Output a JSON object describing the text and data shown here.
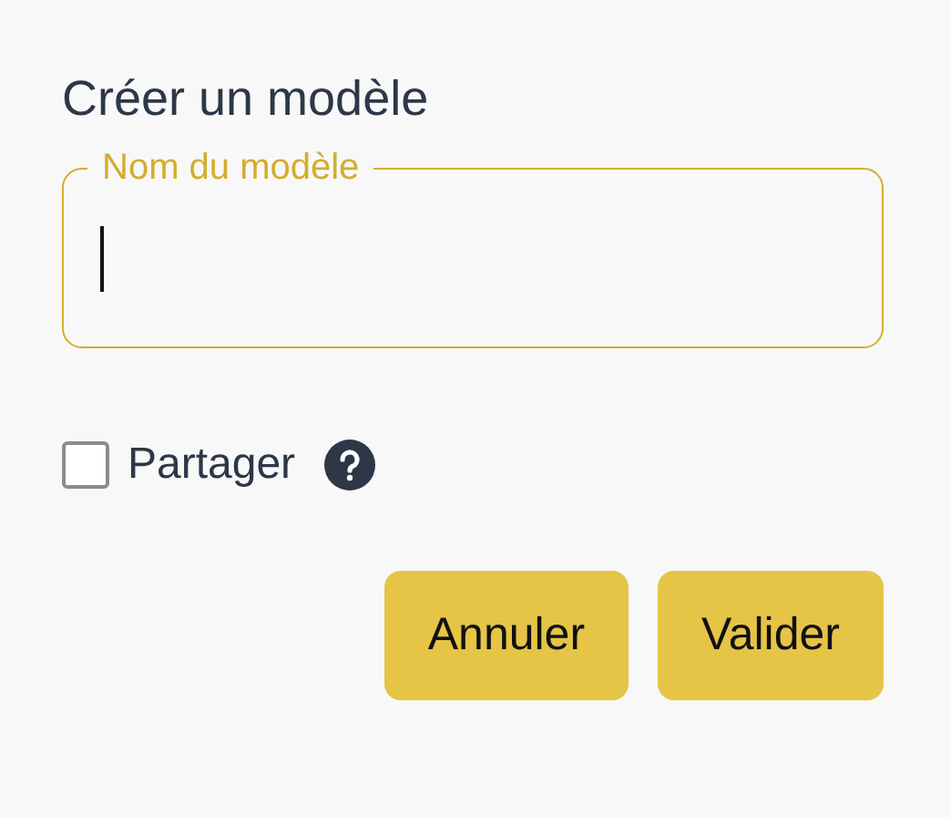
{
  "title": "Créer un modèle",
  "field": {
    "label": "Nom du modèle",
    "focused": true
  },
  "share": {
    "label": "Partager",
    "checked": false
  },
  "buttons": [
    {
      "label": "Annuler"
    },
    {
      "label": "Valider"
    }
  ]
}
